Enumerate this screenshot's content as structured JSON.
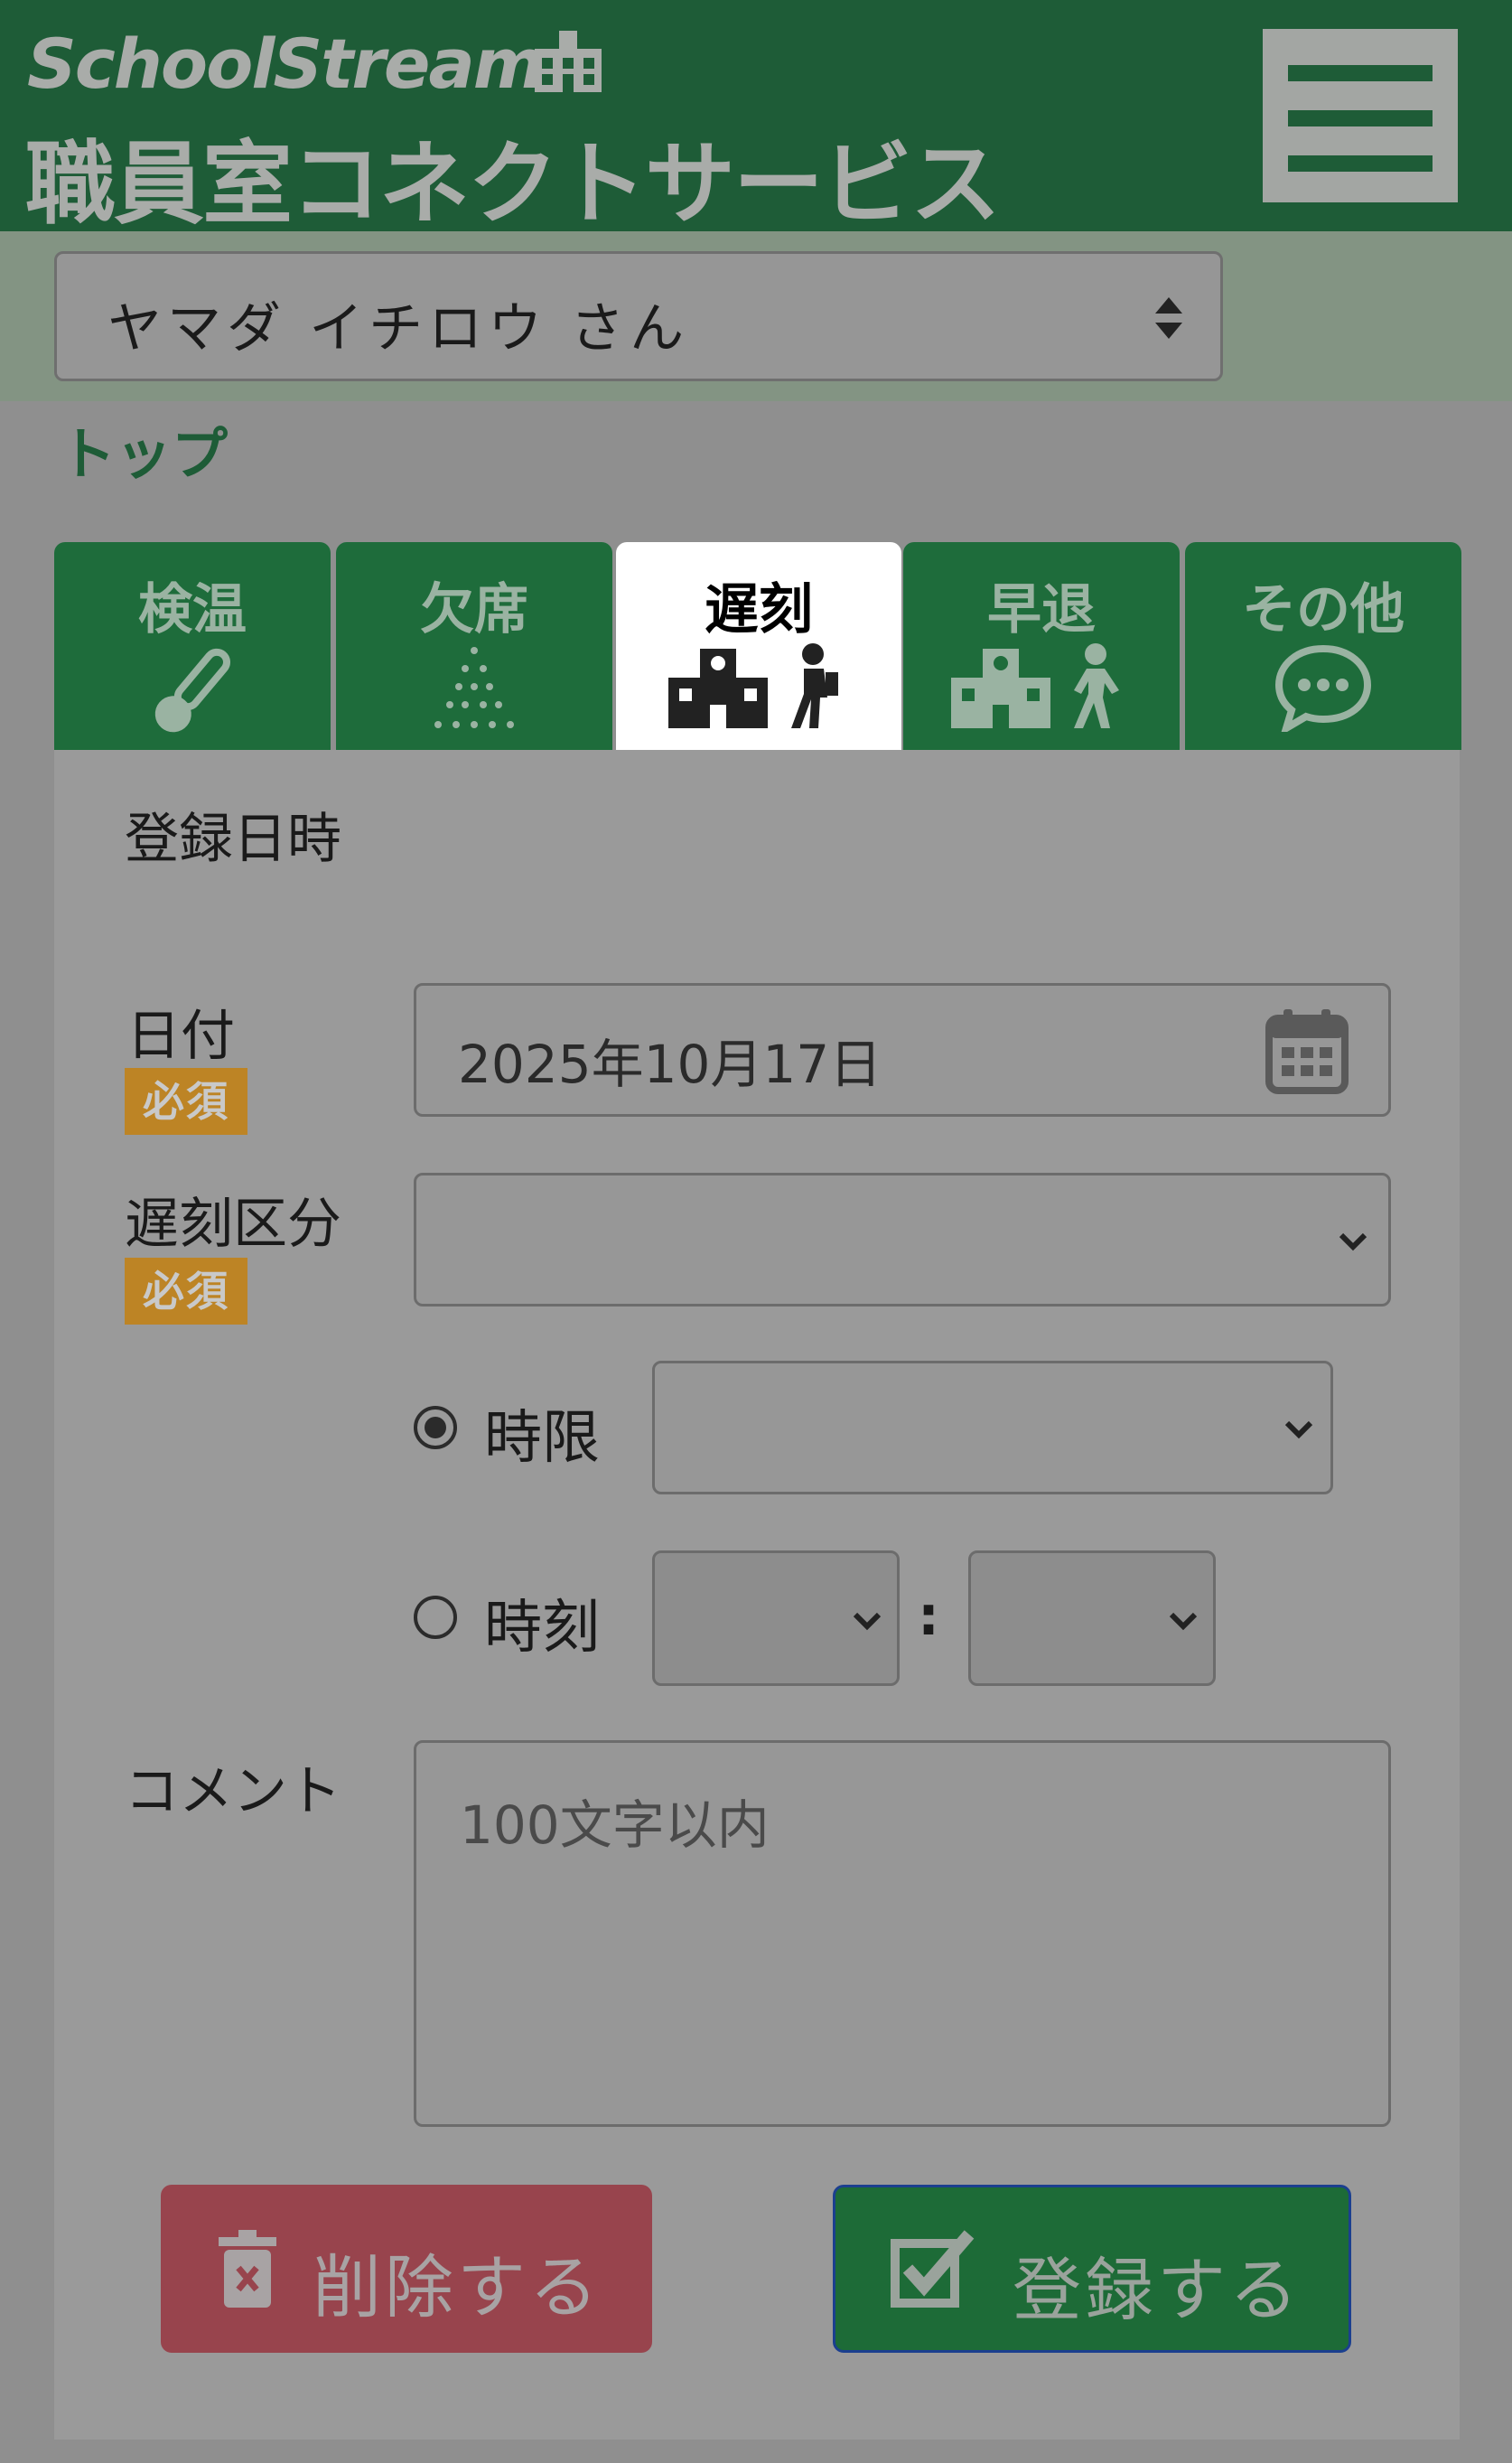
{
  "header": {
    "brand": "SchoolStream",
    "subtitle": "職員室コネクトサービス",
    "menu_icon": "hamburger-icon"
  },
  "user_select": {
    "value": "ヤマダ イチロウ さん"
  },
  "breadcrumb": "トップ",
  "tabs": [
    {
      "label": "検温",
      "icon": "thermometer-icon",
      "active": false
    },
    {
      "label": "欠席",
      "icon": "dots-icon",
      "active": false
    },
    {
      "label": "遅刻",
      "icon": "school-walk-in-icon",
      "active": true
    },
    {
      "label": "早退",
      "icon": "school-walk-out-icon",
      "active": false
    },
    {
      "label": "その他",
      "icon": "chat-bubble-icon",
      "active": false
    }
  ],
  "form": {
    "section_title": "登録日時",
    "required_badge": "必須",
    "date_label": "日付",
    "date_value": "2025年10月17日",
    "category_label": "遅刻区分",
    "category_value": "",
    "period_label": "時限",
    "period_selected": true,
    "period_value": "",
    "time_label": "時刻",
    "time_selected": false,
    "time_separator": ":",
    "hour_value": "",
    "minute_value": "",
    "comment_label": "コメント",
    "comment_placeholder": "100文字以内"
  },
  "buttons": {
    "delete_label": "削除する",
    "register_label": "登録する"
  },
  "colors": {
    "header": "#1e5c37",
    "tab": "#1e6c3b",
    "required": "#bd8425",
    "delete": "#98444d",
    "register": "#1d6b37"
  }
}
